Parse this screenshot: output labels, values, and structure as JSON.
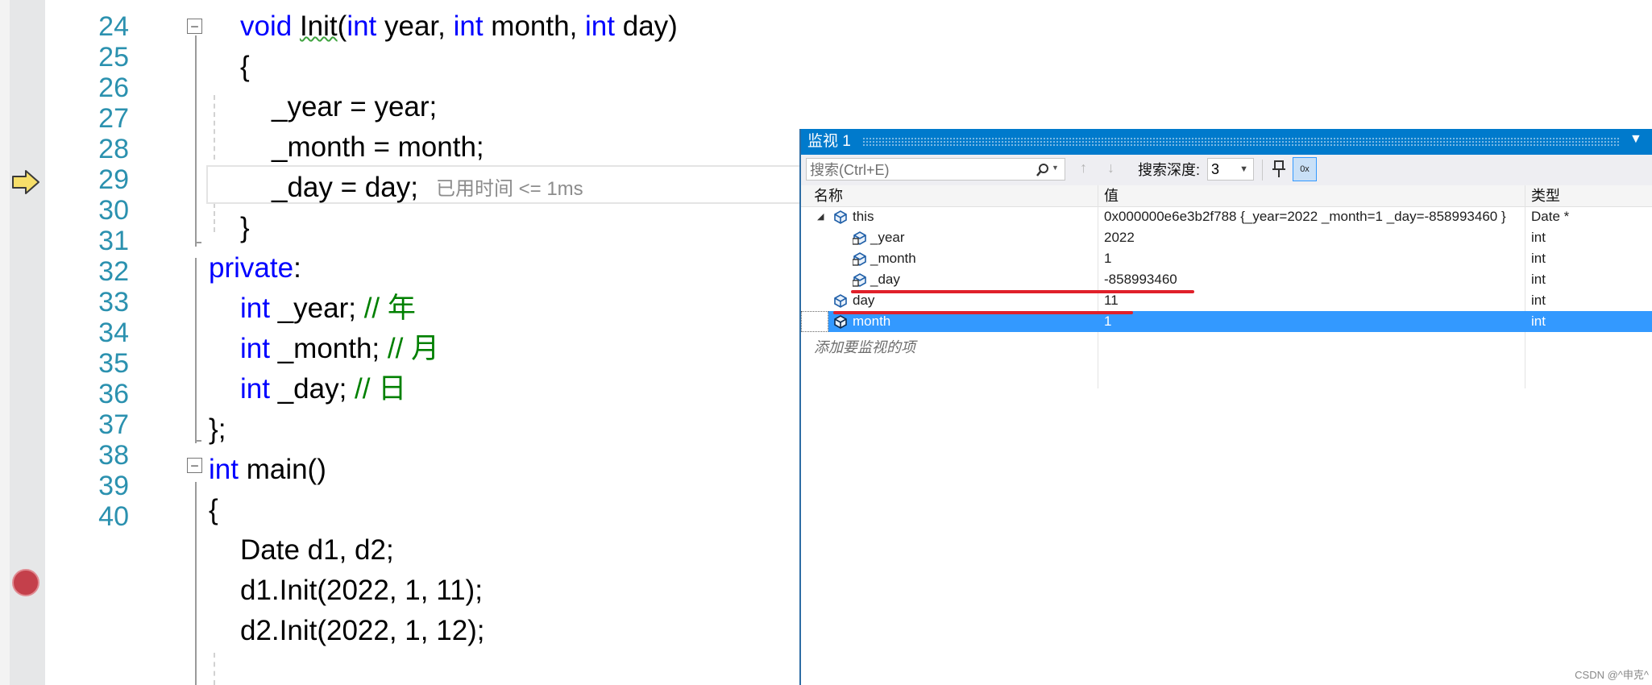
{
  "editor": {
    "line_numbers": [
      "24",
      "25",
      "26",
      "27",
      "28",
      "29",
      "30",
      "31",
      "32",
      "33",
      "34",
      "35",
      "36",
      "37",
      "38",
      "39",
      "40"
    ],
    "lines": {
      "l24": {
        "kw_void": "void",
        "fn": "Init",
        "p1": "(",
        "kw_int1": "int",
        "a1": " year, ",
        "kw_int2": "int",
        "a2": " month, ",
        "kw_int3": "int",
        "a3": " day)"
      },
      "l25": "{",
      "l26": "_year = year;",
      "l27": "_month = month;",
      "l28": {
        "code": "_day = day;",
        "elapsed": "已用时间 <= 1ms"
      },
      "l29": "}",
      "l30": {
        "kw": "private",
        "rest": ":"
      },
      "l31": {
        "kw": "int",
        "rest": " _year; ",
        "comment": "// 年"
      },
      "l32": {
        "kw": "int",
        "rest": " _month; ",
        "comment": "// 月"
      },
      "l33": {
        "kw": "int",
        "rest": " _day; ",
        "comment": "// 日"
      },
      "l34": "};",
      "l35": {
        "kw": "int",
        "rest": " main()"
      },
      "l36": "{",
      "l37": "Date d1, d2;",
      "l38": "d1.Init(2022, 1, 11);",
      "l39": "d2.Init(2022, 1, 12);",
      "l40": ""
    },
    "collapse_glyph": "−"
  },
  "watch": {
    "title": "监视 1",
    "search_placeholder": "搜索(Ctrl+E)",
    "depth_label": "搜索深度:",
    "depth_value": "3",
    "hex_label": "0x",
    "columns": {
      "name": "名称",
      "value": "值",
      "type": "类型"
    },
    "rows": [
      {
        "name": "this",
        "value": "0x000000e6e3b2f788 {_year=2022 _month=1 _day=-858993460 }",
        "type": "Date *"
      },
      {
        "name": "_year",
        "value": "2022",
        "type": "int"
      },
      {
        "name": "_month",
        "value": "1",
        "type": "int"
      },
      {
        "name": "_day",
        "value": "-858993460",
        "type": "int"
      },
      {
        "name": "day",
        "value": "11",
        "type": "int"
      },
      {
        "name": "month",
        "value": "1",
        "type": "int"
      }
    ],
    "add_watch": "添加要监视的项"
  },
  "watermark": "CSDN @^申克^",
  "colors": {
    "keyword": "#0000ff",
    "comment": "#008000",
    "line_number": "#2b91af",
    "accent": "#007acc",
    "selection": "#3399ff",
    "annotation": "#e0202a"
  }
}
